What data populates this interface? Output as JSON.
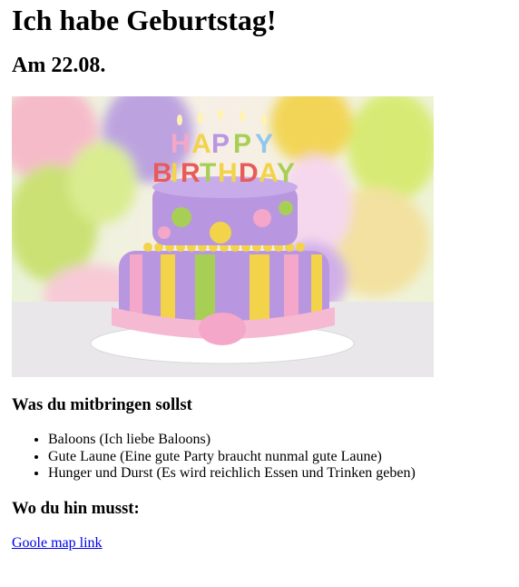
{
  "page": {
    "title": "Ich habe Geburtstag!",
    "date": "Am 22.08."
  },
  "hero": {
    "candle_letters": "HAPPY BIRTHDAY",
    "colors": {
      "purple": "#a98ad6",
      "pink": "#f4a7c8",
      "yellow": "#f2d34a",
      "green": "#a8cf55",
      "background": "#f3f0f2"
    }
  },
  "bring": {
    "heading": "Was du mitbringen sollst",
    "items": [
      "Baloons (Ich liebe Baloons)",
      "Gute Laune (Eine gute Party braucht nunmal gute Laune)",
      "Hunger und Durst (Es wird reichlich Essen und Trinken geben)"
    ]
  },
  "location": {
    "heading": "Wo du hin musst:",
    "link_label": "Goole map link"
  }
}
